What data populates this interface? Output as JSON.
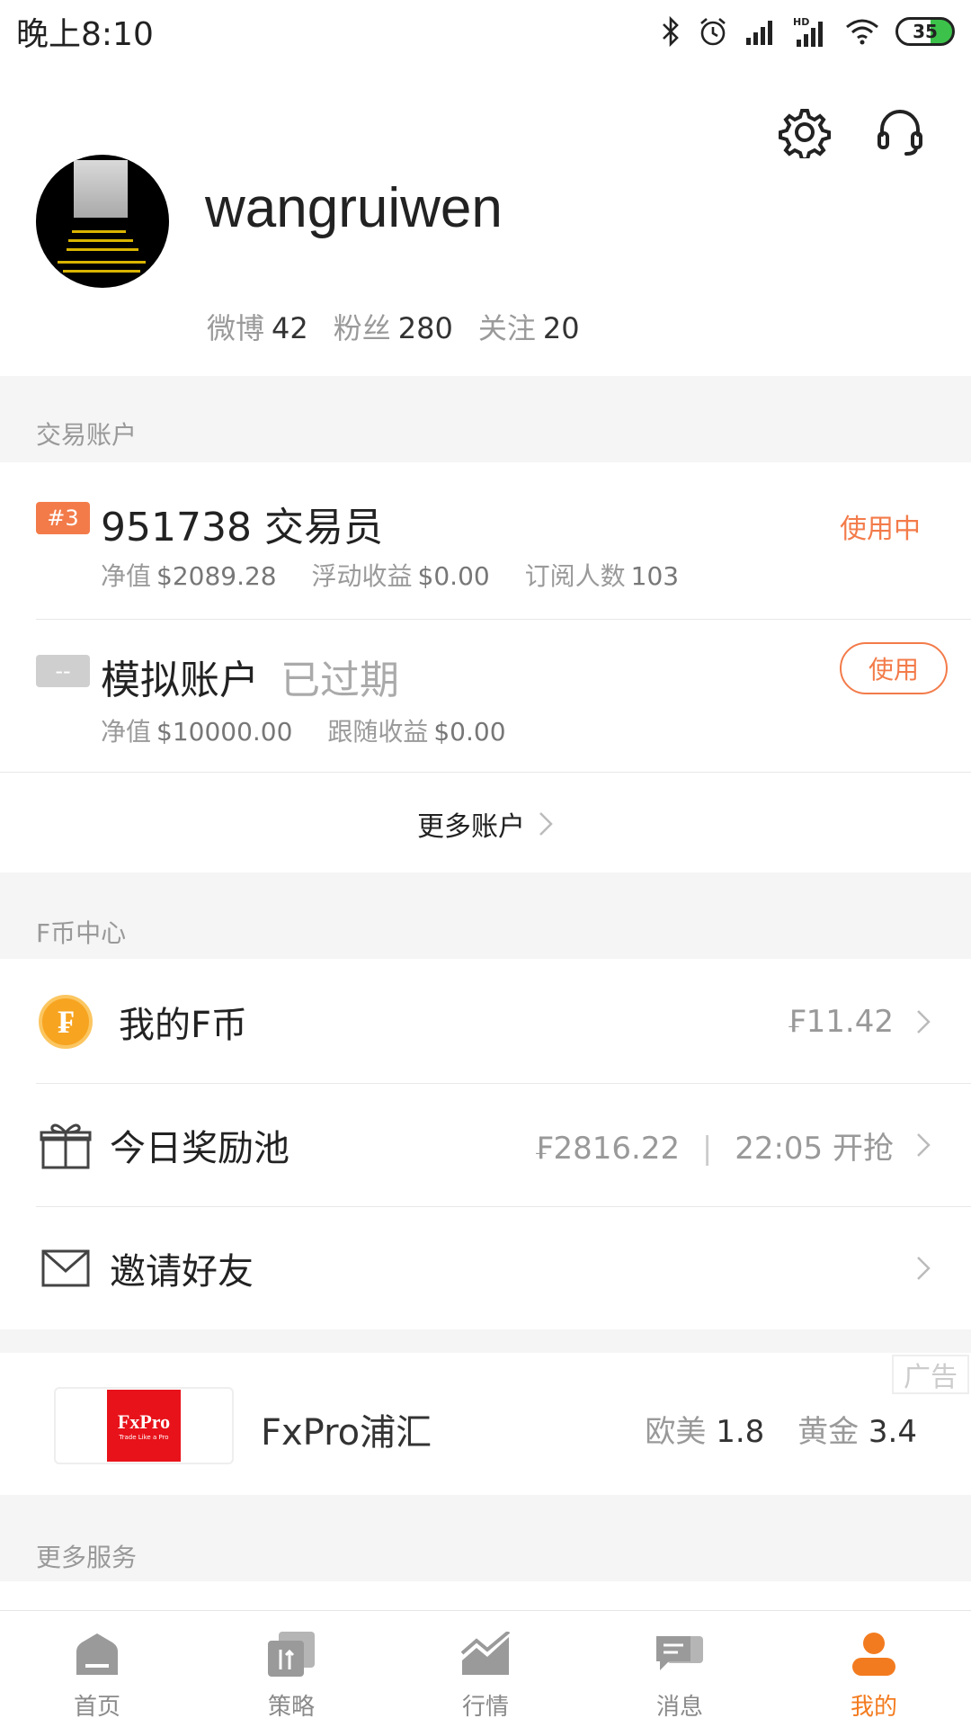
{
  "status_bar": {
    "time": "晚上8:10",
    "battery": "35"
  },
  "profile": {
    "username": "wangruiwen",
    "stats": [
      {
        "label": "微博",
        "value": "42"
      },
      {
        "label": "粉丝",
        "value": "280"
      },
      {
        "label": "关注",
        "value": "20"
      }
    ]
  },
  "trading": {
    "section_title": "交易账户",
    "account1": {
      "tag": "#3",
      "title": "951738 交易员",
      "status": "使用中",
      "equity_label": "净值",
      "equity": "$2089.28",
      "float_label": "浮动收益",
      "float": "$0.00",
      "subs_label": "订阅人数",
      "subs": "103"
    },
    "account2": {
      "tag": "--",
      "title": "模拟账户",
      "expired": "已过期",
      "button": "使用",
      "equity_label": "净值",
      "equity": "$10000.00",
      "follow_label": "跟随收益",
      "follow": "$0.00"
    },
    "more_accounts": "更多账户"
  },
  "fcoin": {
    "section_title": "F币中心",
    "my_coin": {
      "label": "我的F币",
      "value": "₣11.42"
    },
    "reward": {
      "label": "今日奖励池",
      "value": "₣2816.22",
      "sep": "|",
      "time": "22:05 开抢"
    },
    "invite": {
      "label": "邀请好友"
    }
  },
  "ad": {
    "badge": "广告",
    "logo_text": "FxPro",
    "logo_sub": "Trade Like a Pro",
    "name": "FxPro浦汇",
    "m1_label": "欧美",
    "m1_value": "1.8",
    "m2_label": "黄金",
    "m2_value": "3.4"
  },
  "more_services": {
    "section_title": "更多服务"
  },
  "nav": {
    "items": [
      {
        "label": "首页"
      },
      {
        "label": "策略"
      },
      {
        "label": "行情"
      },
      {
        "label": "消息"
      },
      {
        "label": "我的"
      }
    ]
  },
  "colors": {
    "accent": "#f37b4a",
    "nav_active": "#f37b1f",
    "tag_active": "#f37b4a",
    "tag_inactive": "#cfcfcf"
  }
}
